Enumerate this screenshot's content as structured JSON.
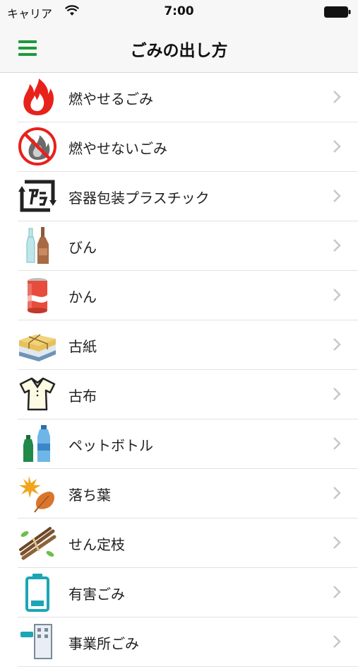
{
  "status": {
    "carrier": "キャリア",
    "time": "7:00"
  },
  "header": {
    "title": "ごみの出し方",
    "menu_icon": "hamburger-menu-icon",
    "accent_color": "#1f9a3a"
  },
  "items": [
    {
      "label": "燃やせるごみ",
      "icon": "flame-icon"
    },
    {
      "label": "燃やせないごみ",
      "icon": "no-flame-icon"
    },
    {
      "label": "容器包装プラスチック",
      "icon": "plastic-recycle-icon"
    },
    {
      "label": "びん",
      "icon": "bottles-icon"
    },
    {
      "label": "かん",
      "icon": "can-icon"
    },
    {
      "label": "古紙",
      "icon": "paper-bundle-icon"
    },
    {
      "label": "古布",
      "icon": "shirt-icon"
    },
    {
      "label": "ペットボトル",
      "icon": "pet-bottle-icon"
    },
    {
      "label": "落ち葉",
      "icon": "leaves-icon"
    },
    {
      "label": "せん定枝",
      "icon": "branches-icon"
    },
    {
      "label": "有害ごみ",
      "icon": "battery-icon"
    },
    {
      "label": "事業所ごみ",
      "icon": "office-building-icon"
    }
  ]
}
